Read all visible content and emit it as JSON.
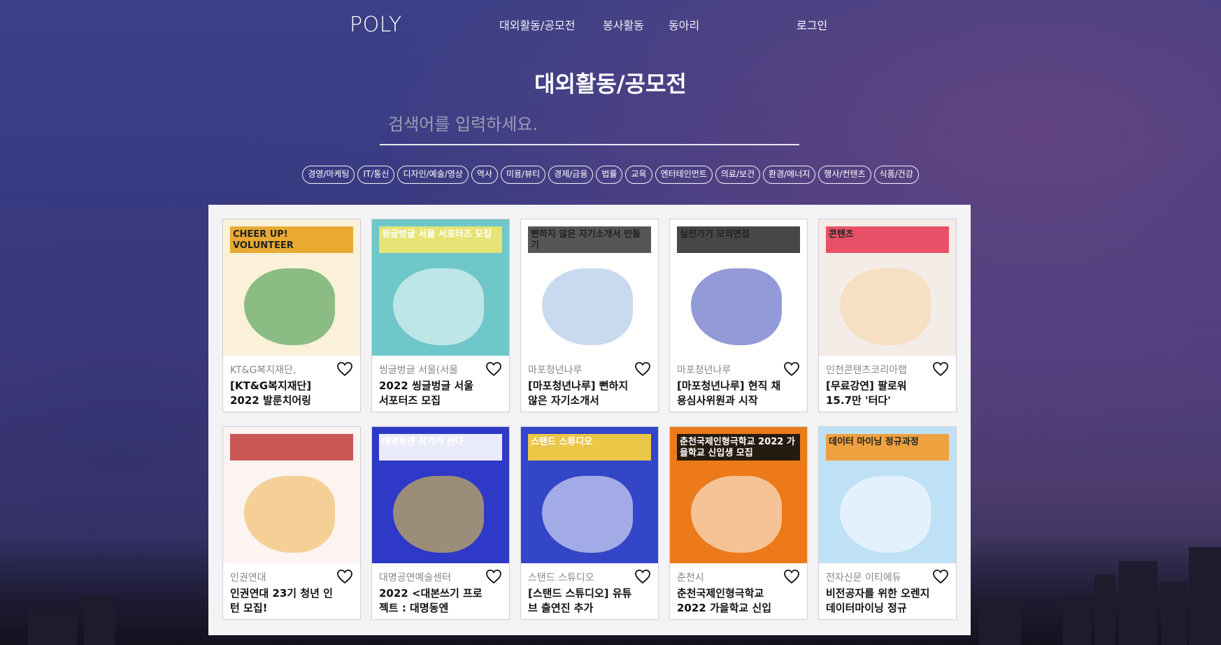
{
  "nav": {
    "logo": "POLY",
    "links": [
      "대외활동/공모전",
      "봉사활동",
      "동아리"
    ],
    "login": "로그인"
  },
  "page": {
    "title": "대외활동/공모전",
    "search_placeholder": "검색어를 입력하세요."
  },
  "categories": [
    "경영/마케팅",
    "IT/통신",
    "디자인/예술/영상",
    "역사",
    "미용/뷰티",
    "경제/금융",
    "법률",
    "교육",
    "엔터테인먼트",
    "의료/보건",
    "환경/에너지",
    "행사/컨텐츠",
    "식품/건강"
  ],
  "cards": [
    {
      "org": "KT&G복지재단,",
      "title": "[KT&G복지재단] 2022 발룬치어링",
      "thumb_text": "CHEER UP! VOLUNTEER",
      "colors": [
        "#fbf1d9",
        "#e6a21f",
        "#2f8f3e"
      ]
    },
    {
      "org": "씽글벙글 서울(서울",
      "title": "2022 씽글벙글 서울 서포터즈 모집",
      "thumb_text": "씽글벙글 서울 서포터즈 모집",
      "colors": [
        "#6fc7c9",
        "#f4e56a",
        "#ffffff"
      ]
    },
    {
      "org": "마포청년나루",
      "title": "[마포청년나루] 뻔하지 않은 자기소개서",
      "thumb_text": "뻔하지 않은 자기소개서 만들기",
      "colors": [
        "#ffffff",
        "#444444",
        "#9bbbe0"
      ]
    },
    {
      "org": "마포청년나루",
      "title": "[마포청년나루] 현직 채용심사위원과 시작",
      "thumb_text": "실전가기 모의면접",
      "colors": [
        "#ffffff",
        "#333333",
        "#3b47b8"
      ]
    },
    {
      "org": "인천콘텐츠코리아랩",
      "title": "[무료강연] 팔로워 15.7만 '터다'",
      "thumb_text": "콘텐츠",
      "colors": [
        "#f4ece6",
        "#e8405a",
        "#f8d6a6"
      ]
    },
    {
      "org": "인권연대",
      "title": "인권연대 23기 청년 인턴 모집!",
      "thumb_text": "",
      "colors": [
        "#fbf4f1",
        "#c84646",
        "#f0b24a"
      ]
    },
    {
      "org": "대명공연예술센터",
      "title": "2022 <대본쓰기 프로젝트 : 대명동엔",
      "thumb_text": "대명동엔 작가가 산다",
      "colors": [
        "#2e39c7",
        "#ffffff",
        "#f6d338"
      ]
    },
    {
      "org": "스탠드 스튜디오",
      "title": "[스탠드 스튜디오] 유튜브 출연진 추가",
      "thumb_text": "스탠드 스튜디오",
      "colors": [
        "#3346c8",
        "#ffd53a",
        "#ffffff"
      ]
    },
    {
      "org": "춘천시",
      "title": "춘천국제인형극학교 2022 가을학교 신입",
      "thumb_text": "춘천국제인형극학교 2022 가을학교 신입생 모집",
      "colors": [
        "#ec7a1a",
        "#111111",
        "#ffffff"
      ]
    },
    {
      "org": "전자신문 이티에듀",
      "title": "비전공자를 위한 오렌지 데이터마이닝 정규",
      "thumb_text": "데이터 마이닝 정규과정",
      "colors": [
        "#bfe1f6",
        "#f39a2b",
        "#ffffff"
      ]
    }
  ]
}
